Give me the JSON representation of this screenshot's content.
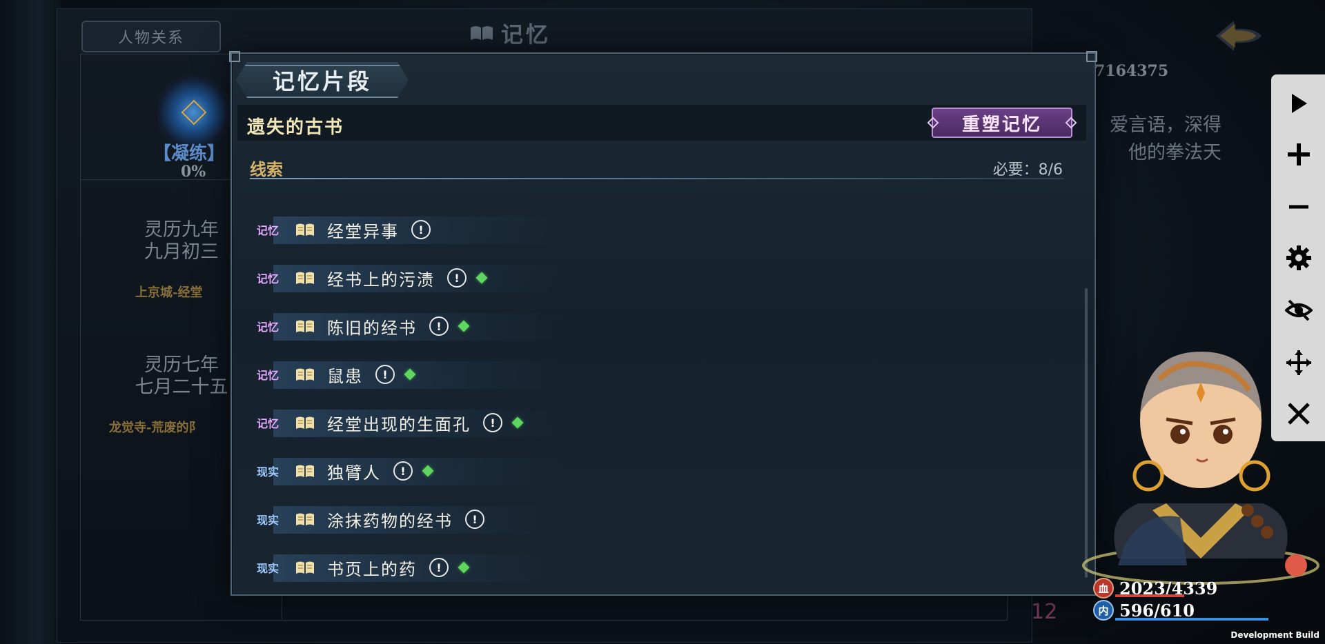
{
  "background": {
    "tab_relations": "人物关系",
    "title": "记忆",
    "number": "7164375",
    "description": [
      "爱言语，深得",
      "他的拳法天"
    ],
    "refine_label": "【凝练】",
    "refine_percent": "0%",
    "entries": [
      {
        "date_line1": "灵历九年",
        "date_line2": "九月初三",
        "place": "上京城-经堂"
      },
      {
        "date_line1": "灵历七年",
        "date_line2": "七月二十五",
        "place": "龙觉寺-荒废的阝"
      }
    ],
    "page_number": "12"
  },
  "modal": {
    "title": "记忆片段",
    "subtitle": "遗失的古书",
    "reshape_button": "重塑记忆",
    "clue_header": "线索",
    "required_text": "必要：8/6",
    "clues": [
      {
        "tag": "记忆",
        "kind": "memory",
        "text": "经堂异事",
        "alert": "!",
        "diamond": false
      },
      {
        "tag": "记忆",
        "kind": "memory",
        "text": "经书上的污渍",
        "alert": "!",
        "diamond": true
      },
      {
        "tag": "记忆",
        "kind": "memory",
        "text": "陈旧的经书",
        "alert": "!",
        "diamond": true
      },
      {
        "tag": "记忆",
        "kind": "memory",
        "text": "鼠患",
        "alert": "!",
        "diamond": true
      },
      {
        "tag": "记忆",
        "kind": "memory",
        "text": "经堂出现的生面孔",
        "alert": "!",
        "diamond": true
      },
      {
        "tag": "现实",
        "kind": "reality",
        "text": "独臂人",
        "alert": "!",
        "diamond": true
      },
      {
        "tag": "现实",
        "kind": "reality",
        "text": "涂抹药物的经书",
        "alert": "!",
        "diamond": false
      },
      {
        "tag": "现实",
        "kind": "reality",
        "text": "书页上的药",
        "alert": "!",
        "diamond": true
      }
    ]
  },
  "toolbar": {
    "items": [
      "play-icon",
      "plus-icon",
      "minus-icon",
      "gear-icon",
      "eye-off-icon",
      "move-icon",
      "close-icon"
    ]
  },
  "stats": {
    "hp_badge": "血",
    "hp": "2023/4339",
    "hp_fraction": 0.466,
    "mp_badge": "内",
    "mp": "596/610",
    "mp_fraction": 0.977
  },
  "footer": {
    "dev_build": "Development Build"
  },
  "colors": {
    "memory_tag": "#e6a9ff",
    "reality_tag": "#9ecbff",
    "diamond": "#5fd65f",
    "reshape_button": "#6a3f86",
    "subtitle": "#f0e6b8"
  }
}
